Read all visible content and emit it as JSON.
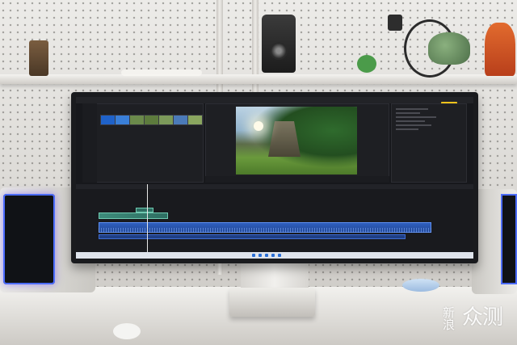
{
  "scene": {
    "description_tags": [
      "desk-setup",
      "ultrawide-monitor",
      "video-editor"
    ],
    "accent_colors": {
      "video_track": "#3d8b7a",
      "audio_track": "#2f5fbf",
      "export_button": "#f2c21b",
      "speaker_glow": "#4c6cff"
    }
  },
  "watermark": {
    "glyph_left": "新浪",
    "glyph_right": "众测"
  },
  "editor": {
    "panels": [
      "media-pool",
      "viewer",
      "inspector",
      "timeline"
    ],
    "thumbnails": [
      {
        "color": "#1f62c9"
      },
      {
        "color": "#3a7fd8"
      },
      {
        "color": "#6b8a4b"
      },
      {
        "color": "#5d7b3d"
      },
      {
        "color": "#7c9a5a"
      },
      {
        "color": "#4b7ab8"
      },
      {
        "color": "#8aa65f"
      }
    ],
    "icons": [
      "export-icon",
      "playhead-icon"
    ]
  }
}
